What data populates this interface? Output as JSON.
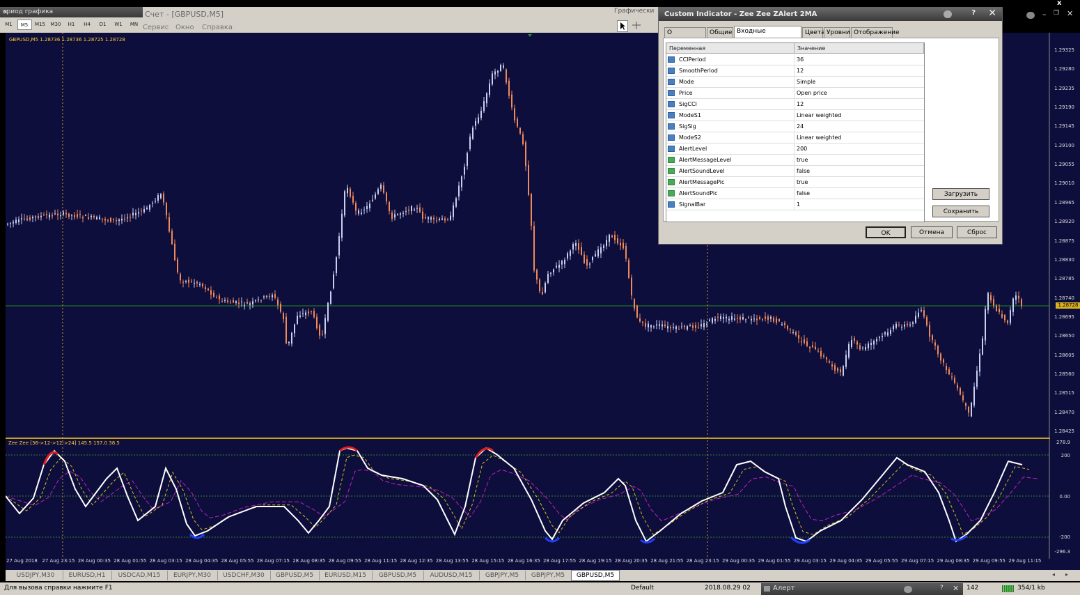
{
  "window": {
    "close_glyph": "x"
  },
  "timeframe_panel": {
    "title": "ериод графика",
    "close": "×",
    "buttons": [
      "M1",
      "M5",
      "M15",
      "M30",
      "H1",
      "H4",
      "D1",
      "W1",
      "MN"
    ],
    "active": "M5"
  },
  "account": {
    "title": "Счет - [GBPUSD,M5]"
  },
  "menu": [
    "Сервис",
    "Окно",
    "Справка"
  ],
  "graph_tools": {
    "title": "Графически"
  },
  "chart": {
    "symbol_label": "GBPUSD,M5  1.28736 1.28736 1.28725 1.28728",
    "indicator_label": "Zee Zee [36->12->12->24] 145.5 157.0 38.5",
    "current_price": "1.28728",
    "price_axis": [
      "1.29325",
      "1.29280",
      "1.29235",
      "1.29190",
      "1.29145",
      "1.29100",
      "1.29055",
      "1.29010",
      "1.28965",
      "1.28920",
      "1.28875",
      "1.28830",
      "1.28785",
      "1.28740",
      "1.28695",
      "1.28650",
      "1.28605",
      "1.28560",
      "1.28515",
      "1.28470",
      "1.28425"
    ],
    "indicator_axis": [
      "278.9",
      "200",
      "0.00",
      "-200",
      "-296.3"
    ],
    "time_axis": [
      "27 Aug 2018",
      "27 Aug 23:15",
      "28 Aug 00:35",
      "28 Aug 01:55",
      "28 Aug 03:15",
      "28 Aug 04:35",
      "28 Aug 05:55",
      "28 Aug 07:15",
      "28 Aug 08:35",
      "28 Aug 09:55",
      "28 Aug 11:15",
      "28 Aug 12:35",
      "28 Aug 13:55",
      "28 Aug 15:15",
      "28 Aug 16:35",
      "28 Aug 17:55",
      "28 Aug 19:15",
      "28 Aug 20:35",
      "28 Aug 21:55",
      "28 Aug 23:15",
      "29 Aug 00:35",
      "29 Aug 01:55",
      "29 Aug 03:15",
      "29 Aug 04:35",
      "29 Aug 05:55",
      "29 Aug 07:15",
      "29 Aug 08:35",
      "29 Aug 09:55",
      "29 Aug 11:15"
    ],
    "colors": {
      "background": "#0e0e3c",
      "bull": "#c8d0f0",
      "bear": "#f08a5a",
      "cci": "#ffffff",
      "signal": "#d4c020",
      "slow": "#c020c0",
      "overbought": "#e02020",
      "oversold": "#2040ff"
    }
  },
  "dialog": {
    "title": "Custom Indicator - Zee Zee ZAlert 2MA",
    "help": "?",
    "close": "✕",
    "tabs": [
      "О программе",
      "Общие",
      "Входные параметры",
      "Цвета",
      "Уровни",
      "Отображение"
    ],
    "active_tab": "Входные параметры",
    "columns": [
      "Переменная",
      "Значение"
    ],
    "params": [
      {
        "name": "CCIPeriod",
        "value": "36",
        "type": "num"
      },
      {
        "name": "SmoothPeriod",
        "value": "12",
        "type": "num"
      },
      {
        "name": "Mode",
        "value": "Simple",
        "type": "num"
      },
      {
        "name": "Price",
        "value": "Open price",
        "type": "num"
      },
      {
        "name": "SigCCI",
        "value": "12",
        "type": "num"
      },
      {
        "name": "ModeS1",
        "value": "Linear weighted",
        "type": "num"
      },
      {
        "name": "SigSig",
        "value": "24",
        "type": "num"
      },
      {
        "name": "ModeS2",
        "value": "Linear weighted",
        "type": "num"
      },
      {
        "name": "AlertLevel",
        "value": "200",
        "type": "num"
      },
      {
        "name": "AlertMessageLevel",
        "value": "true",
        "type": "bool"
      },
      {
        "name": "AlertSoundLevel",
        "value": "false",
        "type": "bool"
      },
      {
        "name": "AlertMessagePic",
        "value": "true",
        "type": "bool"
      },
      {
        "name": "AlertSoundPic",
        "value": "false",
        "type": "bool"
      },
      {
        "name": "SignalBar",
        "value": "1",
        "type": "num"
      }
    ],
    "load": "Загрузить",
    "save": "Сохранить",
    "ok": "OK",
    "cancel": "Отмена",
    "reset": "Сброс"
  },
  "symbol_tabs": [
    "USDJPY,M30",
    "EURUSD,H1",
    "USDCAD,M15",
    "EURJPY,M30",
    "USDCHF,M30",
    "GBPUSD,M5",
    "EURUSD,M15",
    "GBPUSD,M5",
    "AUDUSD,M15",
    "GBPJPY,M5",
    "GBPJPY,M5",
    "GBPUSD,M5"
  ],
  "active_symbol_tab": 11,
  "status": {
    "help": "Для вызова справки нажмите F1",
    "profile": "Default",
    "datetime": "2018.08.29 02",
    "alert": "Алерт",
    "alert_help": "?",
    "alert_close": "✕",
    "bars": "142",
    "traffic": "354/1 kb"
  }
}
